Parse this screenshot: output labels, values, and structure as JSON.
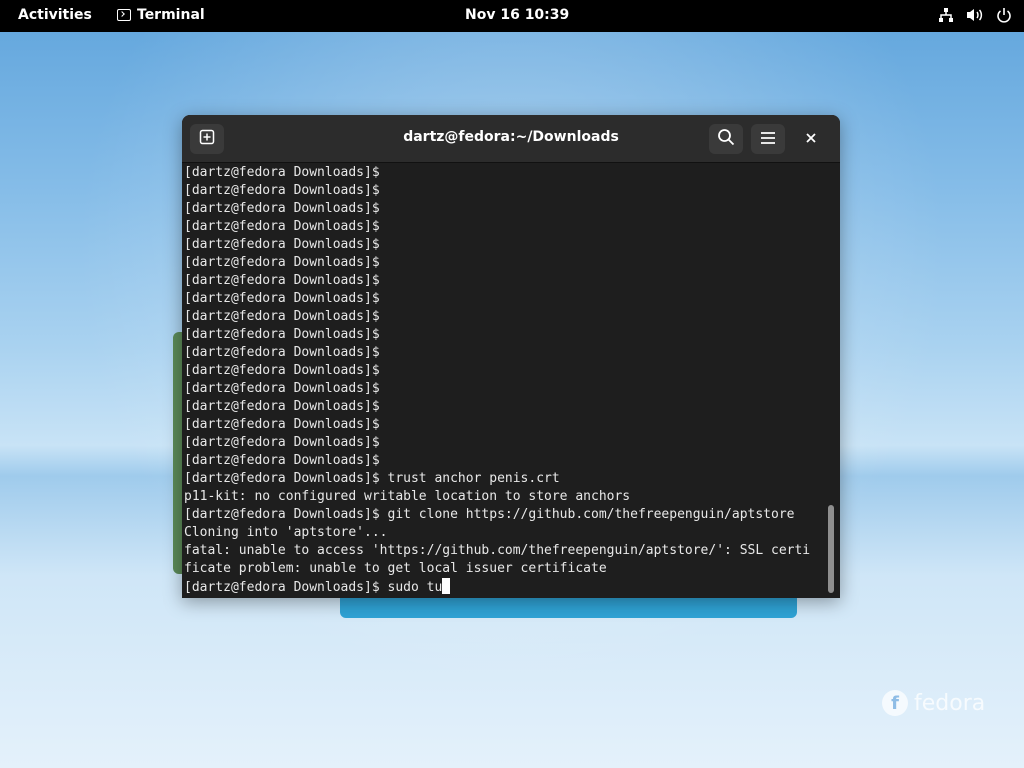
{
  "topbar": {
    "activities_label": "Activities",
    "app_name": "Terminal",
    "clock": "Nov 16  10:39"
  },
  "terminal": {
    "title": "dartz@fedora:~/Downloads",
    "lines": [
      "[dartz@fedora Downloads]$",
      "[dartz@fedora Downloads]$",
      "[dartz@fedora Downloads]$",
      "[dartz@fedora Downloads]$",
      "[dartz@fedora Downloads]$",
      "[dartz@fedora Downloads]$",
      "[dartz@fedora Downloads]$",
      "[dartz@fedora Downloads]$",
      "[dartz@fedora Downloads]$",
      "[dartz@fedora Downloads]$",
      "[dartz@fedora Downloads]$",
      "[dartz@fedora Downloads]$",
      "[dartz@fedora Downloads]$",
      "[dartz@fedora Downloads]$",
      "[dartz@fedora Downloads]$",
      "[dartz@fedora Downloads]$",
      "[dartz@fedora Downloads]$",
      "[dartz@fedora Downloads]$ trust anchor penis.crt",
      "p11-kit: no configured writable location to store anchors",
      "[dartz@fedora Downloads]$ git clone https://github.com/thefreepenguin/aptstore",
      "Cloning into 'aptstore'...",
      "fatal: unable to access 'https://github.com/thefreepenguin/aptstore/': SSL certi",
      "ficate problem: unable to get local issuer certificate"
    ],
    "prompt_line": "[dartz@fedora Downloads]$ sudo tu"
  },
  "desktop": {
    "logo_text": "fedora"
  },
  "icons": {
    "app": "terminal-icon",
    "network": "network-icon",
    "volume": "volume-icon",
    "power": "power-icon",
    "new_tab": "new-tab-icon",
    "search": "search-icon",
    "menu": "hamburger-menu-icon",
    "close": "close-icon"
  }
}
